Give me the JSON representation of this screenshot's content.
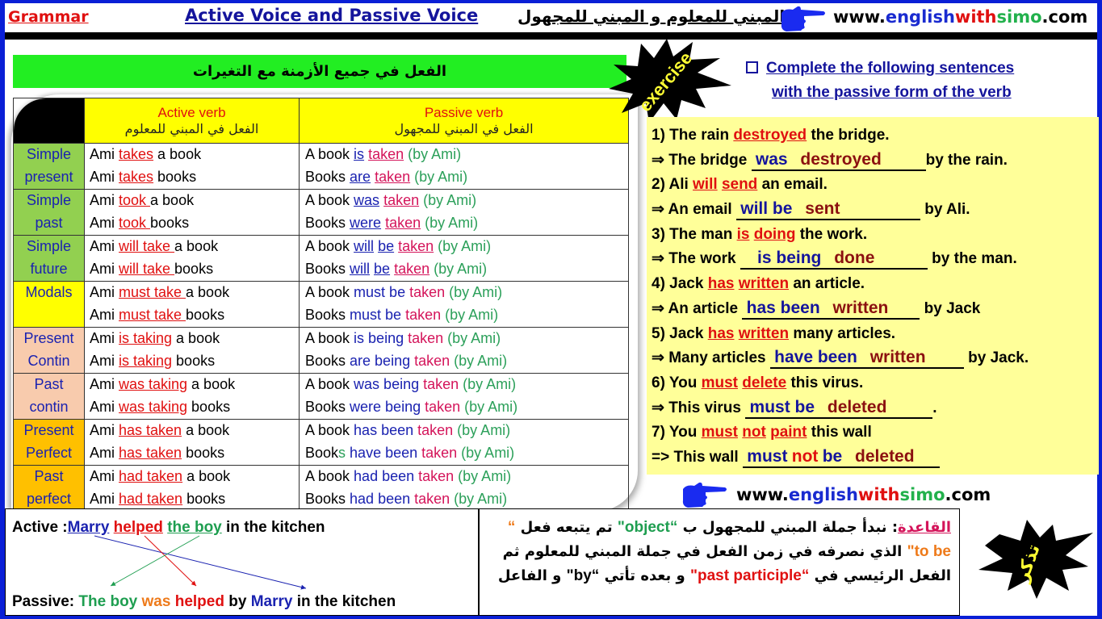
{
  "header": {
    "category": "Grammar",
    "title": "Active Voice and Passive Voice",
    "arabic_title": "المبني للمعلوم و المبني للمجهول",
    "site": {
      "prefix": "www.",
      "part1": "english",
      "part2": "with",
      "part3": "simo",
      "suffix": ".com"
    },
    "pointer_icon": "pointing-hand-icon"
  },
  "banner": {
    "text": "الفعل في جميع الأزمنة مع التغيرات"
  },
  "table": {
    "headers": {
      "active_en": "Active verb",
      "active_ar": "الفعل في المبني للمعلوم",
      "passive_en": "Passive verb",
      "passive_ar": "الفعل في المبني للمجهول"
    },
    "rows": [
      {
        "tense": [
          "Simple",
          "present"
        ],
        "bg": "#92d050",
        "active": [
          {
            "pre": "Ami ",
            "verb": "takes",
            "post": " a book"
          },
          {
            "pre": "Ami ",
            "verb": "takes",
            "post": " books"
          }
        ],
        "passive": [
          {
            "pre": "A book ",
            "aux": "is",
            "pp": "taken",
            "by": " (by Ami)"
          },
          {
            "pre": "Books ",
            "aux": "are",
            "pp": "taken",
            "by": " (by Ami)"
          }
        ]
      },
      {
        "tense": [
          "Simple",
          "past"
        ],
        "bg": "#92d050",
        "active": [
          {
            "pre": "Ami ",
            "verb": "took ",
            "post": "a book"
          },
          {
            "pre": "Ami ",
            "verb": "took ",
            "post": "books"
          }
        ],
        "passive": [
          {
            "pre": "A book ",
            "aux": "was",
            "pp": "taken",
            "by": " (by Ami)"
          },
          {
            "pre": "Books ",
            "aux": "were",
            "pp": "taken",
            "by": " (by Ami)"
          }
        ]
      },
      {
        "tense": [
          "Simple",
          "future"
        ],
        "bg": "#92d050",
        "active": [
          {
            "pre": "Ami ",
            "verb": "will take ",
            "post": "a book"
          },
          {
            "pre": "Ami ",
            "verb": "will take ",
            "post": "books"
          }
        ],
        "passive": [
          {
            "pre": "A book ",
            "aux": "will be",
            "pp": "taken",
            "by": " (by Ami)"
          },
          {
            "pre": "Books ",
            "aux": "will be",
            "pp": "taken",
            "by": " (by Ami)"
          }
        ]
      },
      {
        "tense": [
          "Modals",
          ""
        ],
        "bg": "#ffff00",
        "active": [
          {
            "pre": "Ami ",
            "verb": "must take ",
            "post": "a book"
          },
          {
            "pre": "Ami ",
            "verb": "must take ",
            "post": "books"
          }
        ],
        "passive": [
          {
            "pre": "A book ",
            "aux": "must be",
            "pp": "taken",
            "by": " (by Ami)"
          },
          {
            "pre": "Books ",
            "aux": "must be",
            "pp": "taken",
            "by": " (by Ami)"
          }
        ]
      },
      {
        "tense": [
          "Present",
          "Contin"
        ],
        "bg": "#f8cbad",
        "active": [
          {
            "pre": "Ami ",
            "verb": "is taking",
            "post": " a book"
          },
          {
            "pre": "Ami ",
            "verb": "is taking",
            "post": " books"
          }
        ],
        "passive": [
          {
            "pre": "A book ",
            "aux": "is being",
            "pp": "taken",
            "by": " (by Ami)"
          },
          {
            "pre": "Books ",
            "aux": "are being",
            "pp": "taken",
            "by": " (by Ami)"
          }
        ]
      },
      {
        "tense": [
          "Past",
          "contin"
        ],
        "bg": "#f8cbad",
        "active": [
          {
            "pre": "Ami ",
            "verb": "was taking",
            "post": " a book"
          },
          {
            "pre": "Ami ",
            "verb": "was taking",
            "post": " books"
          }
        ],
        "passive": [
          {
            "pre": "A book ",
            "aux": "was being",
            "pp": "taken",
            "by": " (by Ami)"
          },
          {
            "pre": "Books ",
            "aux": "were being",
            "pp": "taken",
            "by": " (by Ami)"
          }
        ]
      },
      {
        "tense": [
          "Present",
          "Perfect"
        ],
        "bg": "#ffc000",
        "active": [
          {
            "pre": "Ami ",
            "verb": "has taken",
            "post": " a book"
          },
          {
            "pre": "Ami ",
            "verb": "has taken",
            "post": " books"
          }
        ],
        "passive": [
          {
            "pre": "A book ",
            "aux": "has been",
            "pp": "taken",
            "by": " (by Ami)"
          },
          {
            "pre": "Books ",
            "aux": "have been",
            "pp": "taken",
            "by": " (by Ami)"
          }
        ]
      },
      {
        "tense": [
          "Past",
          "perfect"
        ],
        "bg": "#ffc000",
        "active": [
          {
            "pre": "Ami ",
            "verb": "had taken",
            "post": " a book"
          },
          {
            "pre": "Ami ",
            "verb": "had taken",
            "post": " books"
          }
        ],
        "passive": [
          {
            "pre": "A book ",
            "aux": "had been",
            "pp": "taken",
            "by": " (by Ami)"
          },
          {
            "pre": "Books ",
            "aux": "had been",
            "pp": "taken",
            "by": " (by Ami)"
          }
        ]
      }
    ]
  },
  "exercise": {
    "badge": "exercise",
    "instruction_line1": "Complete the following sentences",
    "instruction_line2": "with the passive form of the verb",
    "items": [
      {
        "q": {
          "num": "1)   ",
          "pre": "The rain ",
          "hl": [
            "destroyed"
          ],
          "post": " the bridge."
        },
        "a": {
          "arrow": "⇒",
          "pre": " The bridge ",
          "blue": "was",
          "maroon": "destroyed",
          "post": "by the rain."
        }
      },
      {
        "q": {
          "num": "2) ",
          "pre": "Ali ",
          "hl": [
            "will",
            "send"
          ],
          "post": " an email."
        },
        "a": {
          "arrow": "⇒",
          "pre": " An email ",
          "blue": "will be",
          "maroon": "sent",
          "post": " by Ali."
        }
      },
      {
        "q": {
          "num": "3) ",
          "pre": "The man ",
          "hl": [
            "is",
            "doing"
          ],
          "post": " the work."
        },
        "a": {
          "arrow": "⇒",
          "pre": " The work ",
          "blue": "is being",
          "maroon": "done",
          "post": " by the man."
        }
      },
      {
        "q": {
          "num": "4) ",
          "pre": "Jack ",
          "hl": [
            "has",
            "written"
          ],
          "post": " an article."
        },
        "a": {
          "arrow": "⇒",
          "pre": " An article ",
          "blue": "has been",
          "maroon": "written",
          "post": " by Jack"
        }
      },
      {
        "q": {
          "num": "5) ",
          "pre": "Jack ",
          "hl": [
            "has",
            "written"
          ],
          "post": " many articles."
        },
        "a": {
          "arrow": "⇒",
          "pre": " Many articles ",
          "blue": "have been",
          "maroon": "written",
          "post": " by Jack."
        }
      },
      {
        "q": {
          "num": "6) ",
          "pre": "You ",
          "hl": [
            "must",
            "delete"
          ],
          "post": " this virus."
        },
        "a": {
          "arrow": "⇒",
          "pre": " This virus ",
          "blue": "must be",
          "maroon": "deleted",
          "post": "."
        }
      },
      {
        "q": {
          "num": "7) ",
          "pre": "You ",
          "hl": [
            "must",
            "not",
            "paint"
          ],
          "post": " this wall"
        },
        "a": {
          "arrow": "=>",
          "pre": " This wall ",
          "blue": "must",
          "red": "not",
          "blue2": "be",
          "maroon": "deleted",
          "post": ""
        }
      }
    ]
  },
  "example": {
    "active_label": "Active :",
    "active_subject": "Marry",
    "active_verb": "helped",
    "active_object": "the boy",
    "active_rest": " in the kitchen",
    "passive_label": "Passive: ",
    "passive_subject": "The boy",
    "passive_aux": "was",
    "passive_verb": "helped",
    "passive_by": "by",
    "passive_agent": "Marry",
    "passive_rest": " in the kitchen"
  },
  "rule": {
    "label": "القاعدة",
    "t1": ": نبدأ جملة المبني للمجهول ب ",
    "object": "“object\"",
    "t2": " تم يتبعه فعل ",
    "tobe": "“ to be\"",
    "t3": " الذي نصرفه في زمن الفعل في جملة المبني للمعلوم ثم الفعل الرئيسي في ",
    "pp": "“past participle\"",
    "t4": " و بعده تأتي ",
    "by": "“by\"",
    "t5": " و الفاعل"
  },
  "note_badge": "تذكر",
  "footer": {
    "site": {
      "prefix": "www.",
      "part1": "english",
      "part2": "with",
      "part3": "simo",
      "suffix": ".com"
    }
  }
}
